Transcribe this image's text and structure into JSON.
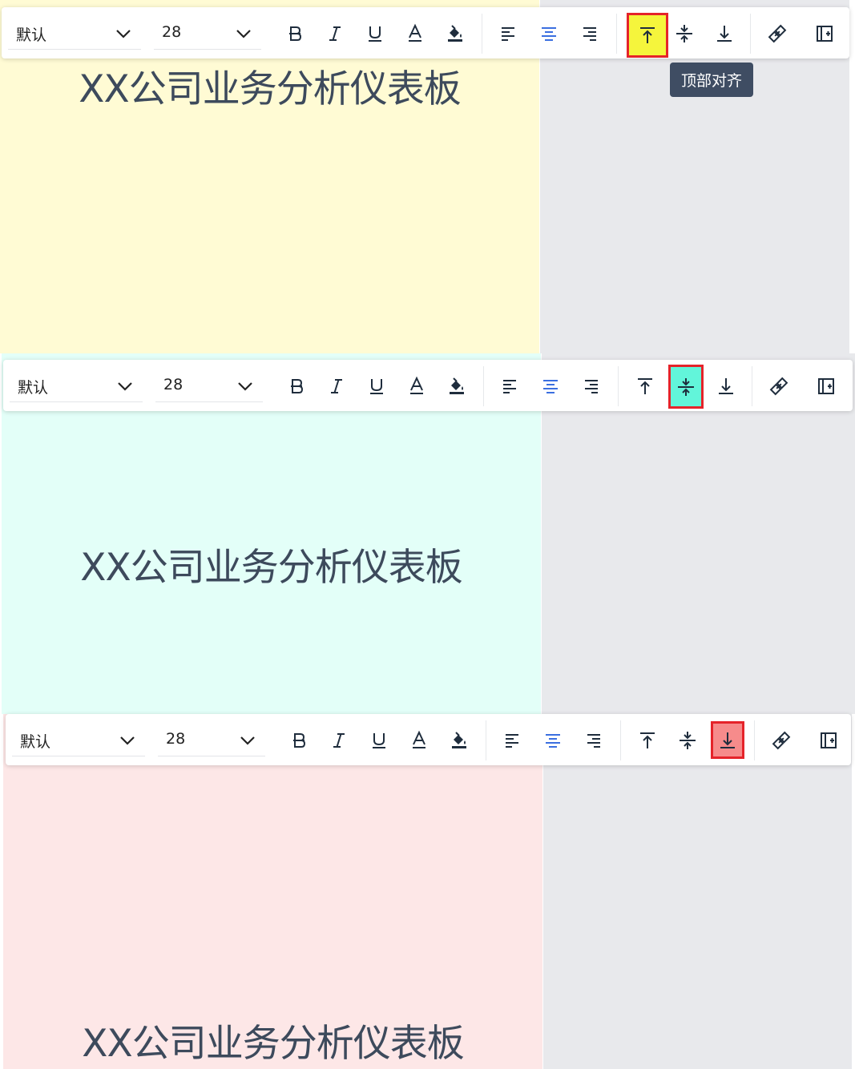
{
  "toolbar": {
    "font_family_value": "默认",
    "font_size_value": "28"
  },
  "tooltip": {
    "text": "顶部对齐"
  },
  "cell_text": "XX公司业务分析仪表板",
  "panels": [
    {
      "variant": "top",
      "cell_color": "#fffbd4",
      "highlight": "valign-top",
      "highlight_color": "#f5f53c"
    },
    {
      "variant": "middle",
      "cell_color": "#e3fff8",
      "highlight": "valign-middle",
      "highlight_color": "#62f5da"
    },
    {
      "variant": "bottom",
      "cell_color": "#fde7e7",
      "highlight": "valign-bottom",
      "highlight_color": "#f68b8b"
    }
  ],
  "icons": [
    "chevron-down-icon",
    "bold-icon",
    "italic-icon",
    "underline-icon",
    "font-color-icon",
    "fill-color-icon",
    "align-left-icon",
    "align-center-icon",
    "align-right-icon",
    "valign-top-icon",
    "valign-middle-icon",
    "valign-bottom-icon",
    "merge-cells-icon",
    "insert-column-icon"
  ]
}
